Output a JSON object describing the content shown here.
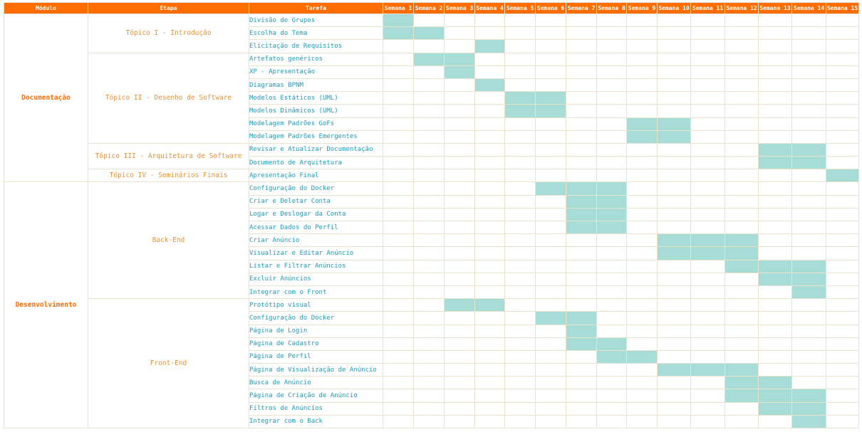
{
  "headers": {
    "modulo": "Módulo",
    "etapa": "Etapa",
    "tarefa": "Tarefa",
    "weeks": [
      "Semana 1",
      "Semana 2",
      "Semana 3",
      "Semana 4",
      "Semana 5",
      "Semana 6",
      "Semana 7",
      "Semana 8",
      "Semana 9",
      "Semana 10",
      "Semana 11",
      "Semana 12",
      "Semana 13",
      "Semana 14",
      "Semana 15"
    ]
  },
  "colors": {
    "header_bg": "#ff6d01",
    "header_text": "#ffffff",
    "modulo_text": "#ff6d01",
    "etapa_text": "#e69138",
    "task_text": "#1b9cba",
    "bar_fill": "#a8dcd6",
    "grid": "#e9e2cf"
  },
  "modules": [
    {
      "name": "Documentação",
      "stages": [
        {
          "name": "Tópico I - Introdução",
          "tasks": [
            {
              "name": "Divisão de Grupos",
              "weeks": [
                1
              ]
            },
            {
              "name": "Escolha do Tema",
              "weeks": [
                1,
                2
              ]
            },
            {
              "name": "Elicitação de Requisitos",
              "weeks": [
                4
              ]
            }
          ]
        },
        {
          "name": "Tópico II - Desenho de Software",
          "tasks": [
            {
              "name": "Artefatos genéricos",
              "weeks": [
                2,
                3
              ]
            },
            {
              "name": "XP - Apresentação",
              "weeks": [
                3
              ]
            },
            {
              "name": "Diagramas BPNM",
              "weeks": [
                4
              ]
            },
            {
              "name": "Modelos Estáticos (UML)",
              "weeks": [
                5,
                6
              ]
            },
            {
              "name": "Modelos Dinâmicos (UML)",
              "weeks": [
                5,
                6
              ]
            },
            {
              "name": "Modelagem Padrões GoFs",
              "weeks": [
                9,
                10
              ]
            },
            {
              "name": "Modelagem Padrões Emergentes",
              "weeks": [
                9,
                10
              ]
            }
          ]
        },
        {
          "name": "Tópico III - Arquitetura de Software",
          "tasks": [
            {
              "name": "Revisar e Atualizar Documentação",
              "weeks": [
                13,
                14
              ]
            },
            {
              "name": "Documento de Arquitetura",
              "weeks": [
                13,
                14
              ]
            }
          ]
        },
        {
          "name": "Tópico IV - Seminários Finais",
          "tasks": [
            {
              "name": "Apresentação Final",
              "weeks": [
                15
              ]
            }
          ]
        }
      ]
    },
    {
      "name": "Desenvolvimento",
      "stages": [
        {
          "name": "Back-End",
          "tasks": [
            {
              "name": "Configuração do Docker",
              "weeks": [
                6,
                7,
                8
              ]
            },
            {
              "name": "Criar e Deletar Conta",
              "weeks": [
                7,
                8
              ]
            },
            {
              "name": "Logar e Deslogar da Conta",
              "weeks": [
                7,
                8
              ]
            },
            {
              "name": "Acessar Dados do Perfil",
              "weeks": [
                7,
                8
              ]
            },
            {
              "name": "Criar Anúncio",
              "weeks": [
                10,
                11,
                12
              ]
            },
            {
              "name": "Visualizar e Editar Anúncio",
              "weeks": [
                10,
                11,
                12
              ]
            },
            {
              "name": "Listar e Filtrar Anúncios",
              "weeks": [
                12,
                13,
                14
              ]
            },
            {
              "name": "Excluir Anúncios",
              "weeks": [
                13,
                14
              ]
            },
            {
              "name": "Integrar com o Front",
              "weeks": [
                14
              ]
            }
          ]
        },
        {
          "name": "Front-End",
          "tasks": [
            {
              "name": "Protótipo visual",
              "weeks": [
                3,
                4
              ]
            },
            {
              "name": "Configuração do Docker",
              "weeks": [
                6,
                7
              ]
            },
            {
              "name": "Página de Login",
              "weeks": [
                7
              ]
            },
            {
              "name": "Página de Cadastro",
              "weeks": [
                7,
                8
              ]
            },
            {
              "name": "Página de Perfil",
              "weeks": [
                8,
                9
              ]
            },
            {
              "name": "Página de Visualização de Anúncio",
              "weeks": [
                10,
                11,
                12
              ]
            },
            {
              "name": "Busca de Anúncio",
              "weeks": [
                12,
                13
              ]
            },
            {
              "name": "Página de Criação de Anúncio",
              "weeks": [
                12,
                13,
                14
              ]
            },
            {
              "name": "Filtros de Anúncios",
              "weeks": [
                13,
                14
              ]
            },
            {
              "name": "Integrar com o Back",
              "weeks": [
                14
              ]
            }
          ]
        }
      ]
    }
  ]
}
